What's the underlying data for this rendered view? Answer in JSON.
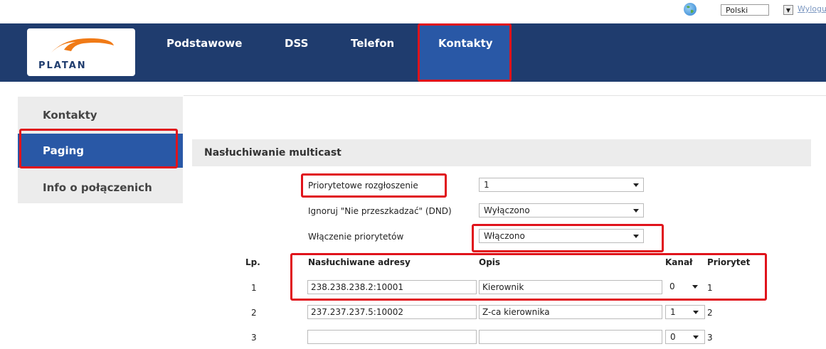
{
  "topbar": {
    "language": "Polski",
    "logout": "Wylogu"
  },
  "logo": {
    "text": "PLATAN"
  },
  "nav": [
    {
      "label": "Podstawowe",
      "active": false
    },
    {
      "label": "DSS",
      "active": false
    },
    {
      "label": "Telefon",
      "active": false
    },
    {
      "label": "Kontakty",
      "active": true
    }
  ],
  "sidebar": [
    {
      "label": "Kontakty",
      "active": false
    },
    {
      "label": "Paging",
      "active": true
    },
    {
      "label": "Info o połączenich",
      "active": false
    }
  ],
  "section": {
    "title": "Nasłuchiwanie multicast",
    "settings": [
      {
        "label": "Priorytetowe rozgłoszenie",
        "value": "1"
      },
      {
        "label": "Ignoruj \"Nie przeszkadzać\" (DND)",
        "value": "Wyłączono"
      },
      {
        "label": "Włączenie priorytetów",
        "value": "Włączono"
      }
    ],
    "table": {
      "headers": {
        "lp": "Lp.",
        "address": "Nasłuchiwane adresy",
        "desc": "Opis",
        "channel": "Kanał",
        "priority": "Priorytet"
      },
      "rows": [
        {
          "lp": "1",
          "address": "238.238.238.2:10001",
          "desc": "Kierownik",
          "channel": "0",
          "priority": "1"
        },
        {
          "lp": "2",
          "address": "237.237.237.5:10002",
          "desc": "Z-ca kierownika",
          "channel": "1",
          "priority": "2"
        },
        {
          "lp": "3",
          "address": "",
          "desc": "",
          "channel": "0",
          "priority": "3"
        }
      ]
    }
  },
  "colors": {
    "nav_bg": "#1f3c6e",
    "active_bg": "#2958a6",
    "highlight": "#e0131b"
  }
}
